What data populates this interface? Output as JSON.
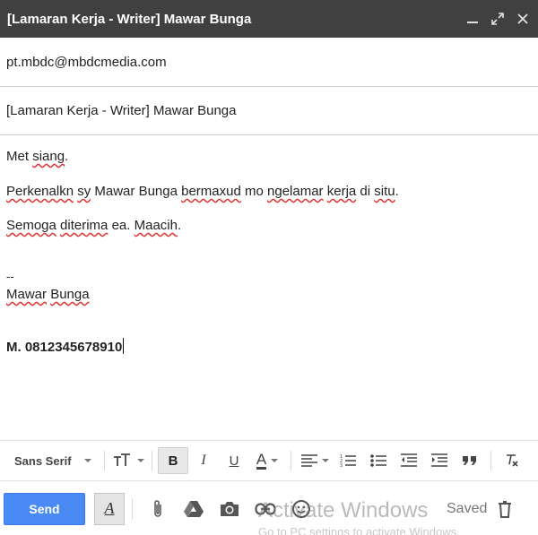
{
  "window": {
    "title": "[Lamaran Kerja - Writer] Mawar Bunga",
    "controls": [
      "minimize-icon",
      "expand-icon",
      "close-icon"
    ]
  },
  "to": {
    "value": "pt.mbdc@mbdcmedia.com"
  },
  "subject": {
    "value": "[Lamaran Kerja - Writer] Mawar Bunga"
  },
  "body": {
    "greeting": {
      "w1": "Met",
      "w2": "siang",
      "end": "."
    },
    "intro": {
      "w1": "Perkenalkn",
      "w2": "sy",
      "w3": "Mawar",
      "w4": "Bunga",
      "w5": "bermaxud",
      "w6": "mo",
      "w7": "ngelamar",
      "w8": "kerja",
      "w9": "di",
      "w10": "situ",
      "end": "."
    },
    "closing": {
      "w1": "Semoga",
      "w2": "diterima",
      "w3": "ea.",
      "w4": "Maacih",
      "end": "."
    },
    "sig_dash": "--",
    "sig_name": {
      "w1": "Mawar",
      "w2": "Bunga"
    },
    "phone": "M. 0812345678910"
  },
  "format_toolbar": {
    "font": "Sans Serif",
    "bold_label": "B",
    "italic_label": "I",
    "underline_label": "U",
    "text_color_label": "A",
    "icons": [
      "text-size-icon",
      "align-icon",
      "numbered-list-icon",
      "bulleted-list-icon",
      "indent-less-icon",
      "indent-more-icon",
      "quote-icon",
      "remove-formatting-icon"
    ]
  },
  "bottom_toolbar": {
    "send_label": "Send",
    "format_label": "A",
    "status": "Saved",
    "icons": [
      "attach-icon",
      "drive-icon",
      "photo-icon",
      "link-icon",
      "emoji-icon",
      "delete-icon"
    ]
  },
  "overlay": {
    "watermark": "Activate Windows",
    "watermark_sub": "Go to PC settings to activate Windows."
  },
  "colors": {
    "titlebar": "#404040",
    "send": "#4a8af4",
    "spell_underline": "#d33"
  }
}
